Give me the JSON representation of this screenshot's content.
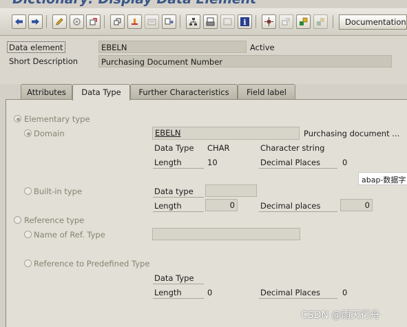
{
  "window_title": "Dictionary: Display Data Element",
  "toolbar": {
    "icons": [
      "back-icon",
      "forward-icon",
      "edit-pencil-icon",
      "display-change-icon",
      "activate-icon",
      "where-used-icon",
      "object-list-icon",
      "navigation-window-icon",
      "move-icon",
      "hierarchy-icon",
      "print-icon",
      "frame-icon",
      "info-icon",
      "tree-expand-icon",
      "transport-icon",
      "append-icon",
      "cancel-append-icon"
    ],
    "documentation_label": "Documentation"
  },
  "header": {
    "data_element_label": "Data element",
    "data_element_value": "EBELN",
    "status": "Active",
    "short_description_label": "Short Description",
    "short_description_value": "Purchasing Document Number"
  },
  "tabs": [
    "Attributes",
    "Data Type",
    "Further Characteristics",
    "Field label"
  ],
  "active_tab": "Data Type",
  "panel": {
    "elementary_type_label": "Elementary type",
    "domain_label": "Domain",
    "domain_value": "EBELN",
    "domain_description": "Purchasing document ...",
    "data_type_label": "Data Type",
    "data_type_value": "CHAR",
    "data_type_description": "Character string",
    "length_label": "Length",
    "length_value": "10",
    "decimal_places_label": "Decimal Places",
    "decimal_places_value": "0",
    "builtin_label": "Built-in type",
    "builtin_data_type_label": "Data type",
    "builtin_length_label": "Length",
    "builtin_length_value": "0",
    "builtin_decimal_label": "Decimal places",
    "builtin_decimal_value": "0",
    "reference_type_label": "Reference type",
    "name_of_ref_label": "Name of Ref. Type",
    "ref_predefined_label": "Reference to Predefined Type",
    "ref_data_type_label": "Data Type",
    "ref_length_label": "Length",
    "ref_length_value": "0",
    "ref_decimal_label": "Decimal Places",
    "ref_decimal_value": "0"
  },
  "tooltip_text": "abap-数据字",
  "watermark": "CSDN @雨天行舟",
  "colors": {
    "background": "#d4d0c8",
    "panel": "#e2dfd6",
    "title": "#39578a"
  }
}
